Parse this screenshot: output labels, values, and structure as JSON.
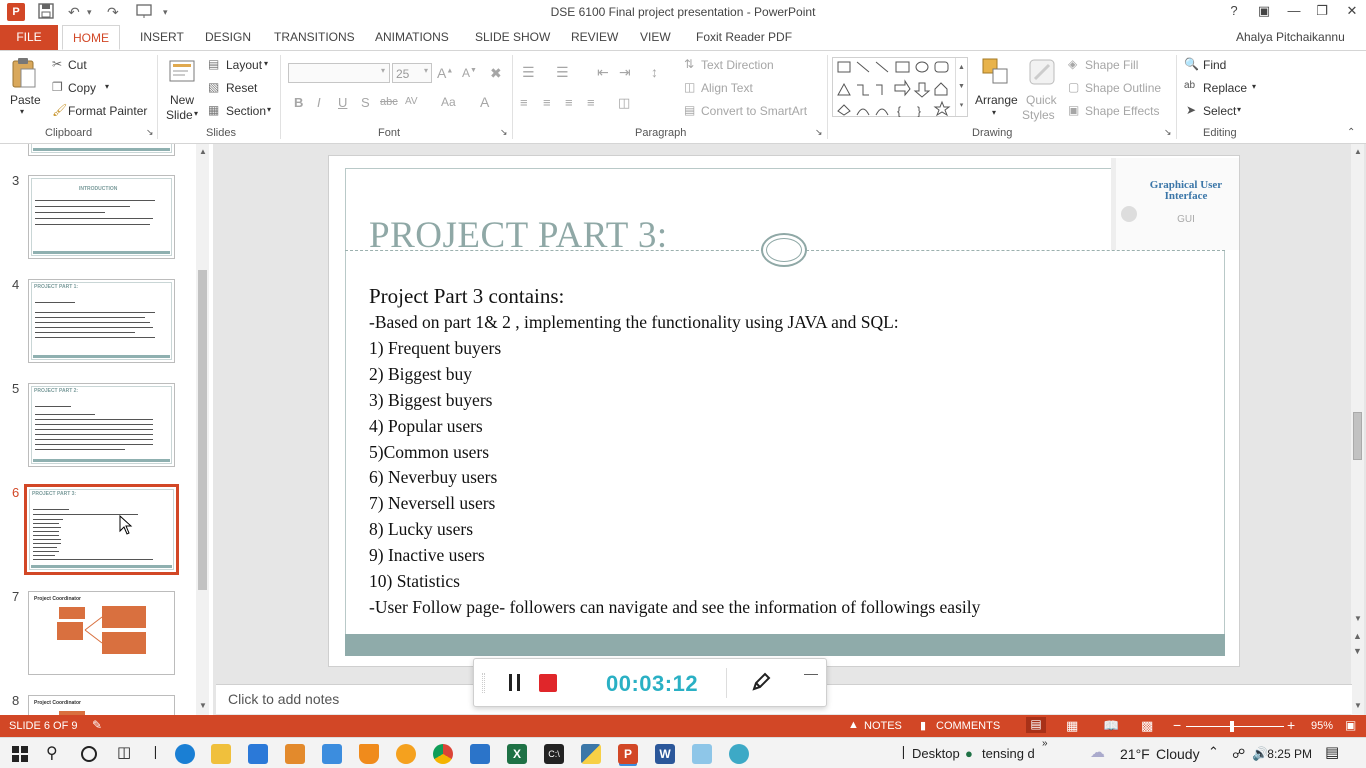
{
  "window": {
    "title": "DSE 6100 Final project presentation - PowerPoint",
    "help": "?",
    "user": "Ahalya Pitchaikannu"
  },
  "tabs": [
    {
      "label": "FILE"
    },
    {
      "label": "HOME"
    },
    {
      "label": "INSERT"
    },
    {
      "label": "DESIGN"
    },
    {
      "label": "TRANSITIONS"
    },
    {
      "label": "ANIMATIONS"
    },
    {
      "label": "SLIDE SHOW"
    },
    {
      "label": "REVIEW"
    },
    {
      "label": "VIEW"
    },
    {
      "label": "Foxit Reader PDF"
    }
  ],
  "ribbon": {
    "clipboard": {
      "paste": "Paste",
      "cut": "Cut",
      "copy": "Copy",
      "format_painter": "Format Painter",
      "label": "Clipboard"
    },
    "slides": {
      "new_slide_1": "New",
      "new_slide_2": "Slide",
      "layout": "Layout",
      "reset": "Reset",
      "section": "Section",
      "label": "Slides"
    },
    "font": {
      "size": "25",
      "bold": "B",
      "italic": "I",
      "underline": "U",
      "shadow": "S",
      "strike": "abc",
      "spacing": "AV",
      "case": "Aa",
      "color": "A",
      "label": "Font"
    },
    "paragraph": {
      "text_direction": "Text Direction",
      "align_text": "Align Text",
      "convert": "Convert to SmartArt",
      "label": "Paragraph"
    },
    "drawing": {
      "arrange": "Arrange",
      "quick_styles_1": "Quick",
      "quick_styles_2": "Styles",
      "shape_fill": "Shape Fill",
      "shape_outline": "Shape Outline",
      "shape_effects": "Shape Effects",
      "label": "Drawing"
    },
    "editing": {
      "find": "Find",
      "replace": "Replace",
      "select": "Select",
      "label": "Editing"
    }
  },
  "thumbnails": [
    {
      "num": "3",
      "title": "INTRODUCTION"
    },
    {
      "num": "4",
      "title": "PROJECT PART 1:"
    },
    {
      "num": "5",
      "title": "PROJECT PART 2:"
    },
    {
      "num": "6",
      "title": "PROJECT PART 3:"
    },
    {
      "num": "7",
      "title": "Project Coordinator"
    },
    {
      "num": "8",
      "title": "Project Coordinator"
    }
  ],
  "slide": {
    "corner_title": "Graphical User Interface",
    "corner_sub": "GUI",
    "title": "PROJECT PART 3:",
    "heading": "Project Part 3 contains:",
    "lines": [
      "-Based on part 1& 2 , implementing  the functionality  using JAVA and SQL:",
      "1) Frequent  buyers",
      "2) Biggest  buy",
      "3) Biggest  buyers",
      "4)  Popular users",
      "5)Common  users",
      "6)  Neverbuy  users",
      "7)  Neversell users",
      "8)  Lucky  users",
      "9)  Inactive users",
      "10)  Statistics",
      "-User Follow page-  followers can navigate  and see the  information  of followings easily"
    ]
  },
  "notes_placeholder": "Click to add notes",
  "recorder": {
    "time": "00:03:12"
  },
  "status": {
    "slide": "SLIDE 6 OF 9",
    "notes": "NOTES",
    "comments": "COMMENTS",
    "zoom": "95%"
  },
  "taskbar": {
    "desktop": "Desktop",
    "user": "tensing d",
    "weather_temp": "21°F",
    "weather_desc": "Cloudy",
    "time": "8:25 PM"
  },
  "colors": {
    "accent": "#d24726",
    "slide_teal": "#8fa8a6",
    "timer": "#2ab0c4"
  }
}
